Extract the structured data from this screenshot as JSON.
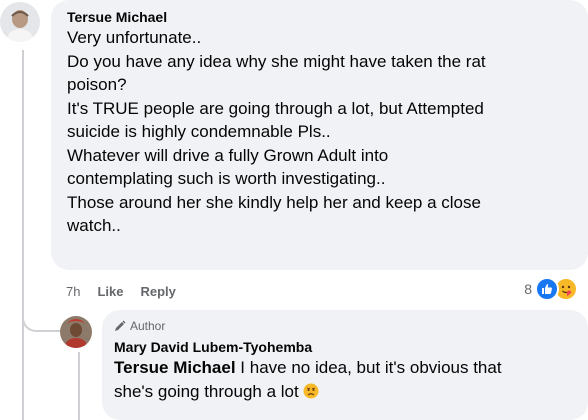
{
  "comment": {
    "author": "Tersue Michael",
    "lines": [
      "Very unfortunate..",
      "Do you have any idea why she might have taken the rat",
      "poison?",
      "It's TRUE people are going through a lot, but Attempted",
      "suicide is highly condemnable Pls..",
      "Whatever will drive a fully Grown Adult into",
      "contemplating such is worth investigating..",
      "Those around her she kindly help her and keep a close",
      "watch.."
    ],
    "time": "7h",
    "like_label": "Like",
    "reply_label": "Reply",
    "reaction_count": "8",
    "reactions": [
      "like-icon",
      "care-icon"
    ]
  },
  "reply": {
    "badge": "Author",
    "author": "Mary David Lubem-Tyohemba",
    "mention": "Tersue Michael",
    "line1_rest": " I have no idea, but it's obvious that",
    "line2": "she's going through a lot ",
    "emoji": "sad-face-emoji"
  },
  "colors": {
    "bubble": "#f0f2f5",
    "meta_text": "#65676b",
    "like_blue": "#1877f2",
    "thread_line": "#ced0d4"
  }
}
